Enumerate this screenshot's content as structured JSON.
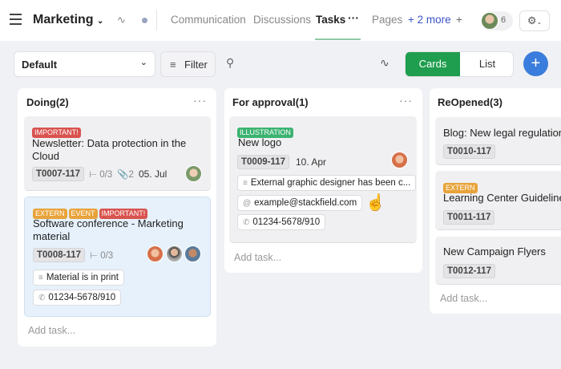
{
  "header": {
    "title": "Marketing",
    "tabs": [
      "Communication",
      "Discussions",
      "Tasks",
      "Pages"
    ],
    "active_tab": "Tasks",
    "more": "+ 2 more",
    "add": "+",
    "member_count": "6"
  },
  "toolbar": {
    "view_select": "Default",
    "filter": "Filter",
    "cards": "Cards",
    "list": "List",
    "accent": "#1e9e4e",
    "add_color": "#3b7ddd"
  },
  "columns": [
    {
      "title": "Doing(2)",
      "add": "Add task...",
      "cards": [
        {
          "tags": [
            "IMPORTANT!"
          ],
          "title": "Newsletter: Data protection in the Cloud",
          "id": "T0007-117",
          "subtasks": "0/3",
          "attachments": "2",
          "date": "05. Jul"
        },
        {
          "tags": [
            "EXTERN",
            "EVENT",
            "IMPORTANT!"
          ],
          "title": "Software conference - Marketing material",
          "id": "T0008-117",
          "subtasks": "0/3",
          "chips": [
            "Material is in print",
            "01234-5678/910"
          ]
        }
      ]
    },
    {
      "title": "For approval(1)",
      "add": "Add task...",
      "cards": [
        {
          "tags": [
            "ILLUSTRATION"
          ],
          "title": "New logo",
          "id": "T0009-117",
          "date": "10. Apr",
          "chips": [
            "External graphic designer has been c...",
            "example@stackfield.com",
            "01234-5678/910"
          ]
        }
      ]
    },
    {
      "title": "ReOpened(3)",
      "add": "Add task...",
      "cards": [
        {
          "title": "Blog: New legal regulations",
          "id": "T0010-117"
        },
        {
          "tags": [
            "EXTERN"
          ],
          "title": "Learning Center Guidelines",
          "id": "T0011-117"
        },
        {
          "title": "New Campaign Flyers",
          "id": "T0012-117"
        }
      ]
    }
  ],
  "tag_colors": {
    "IMPORTANT!": "#d9534f",
    "EXTERN": "#e8a33a",
    "EVENT": "#e8a33a",
    "ILLUSTRATION": "#3cb371"
  }
}
